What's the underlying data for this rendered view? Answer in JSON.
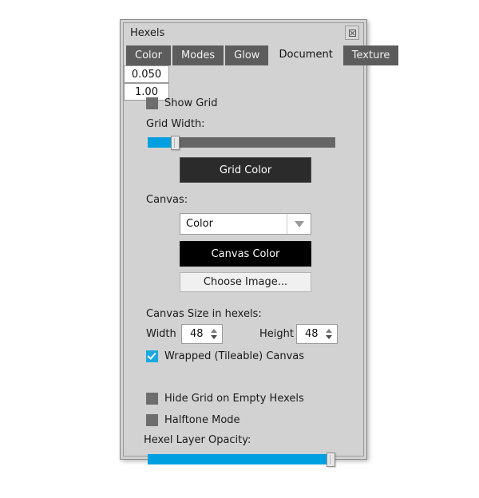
{
  "window": {
    "title": "Hexels",
    "close_icon": "close-icon"
  },
  "tabs": [
    {
      "label": "Color",
      "active": false
    },
    {
      "label": "Modes",
      "active": false
    },
    {
      "label": "Glow",
      "active": false
    },
    {
      "label": "Document",
      "active": true
    },
    {
      "label": "Texture",
      "active": false
    }
  ],
  "document_tab": {
    "show_grid": {
      "label": "Show Grid",
      "checked": false
    },
    "grid_width": {
      "label": "Grid Width:",
      "value": "0.050",
      "slider_percent": 13
    },
    "grid_color_button": "Grid Color",
    "canvas": {
      "label": "Canvas:",
      "selected_option": "Color",
      "options": [
        "Color"
      ],
      "canvas_color_button": "Canvas Color",
      "choose_image_button": "Choose Image..."
    },
    "canvas_size": {
      "label": "Canvas Size in hexels:",
      "width_label": "Width",
      "width_value": "48",
      "height_label": "Height",
      "height_value": "48"
    },
    "wrapped_canvas": {
      "label": "Wrapped (Tileable) Canvas",
      "checked": true
    },
    "hide_grid_empty": {
      "label": "Hide Grid on Empty Hexels",
      "checked": false
    },
    "halftone_mode": {
      "label": "Halftone Mode",
      "checked": false
    },
    "hexel_opacity": {
      "label": "Hexel Layer Opacity:",
      "value": "1.00",
      "slider_percent": 100
    }
  },
  "colors": {
    "accent_blue": "#00a0e0",
    "checkbox_blue": "#19a8e0",
    "panel_bg": "#d2d2d2",
    "tab_inactive": "#5c5c5c",
    "grid_color_swatch": "#2b2b2b",
    "canvas_color_swatch": "#000000"
  }
}
